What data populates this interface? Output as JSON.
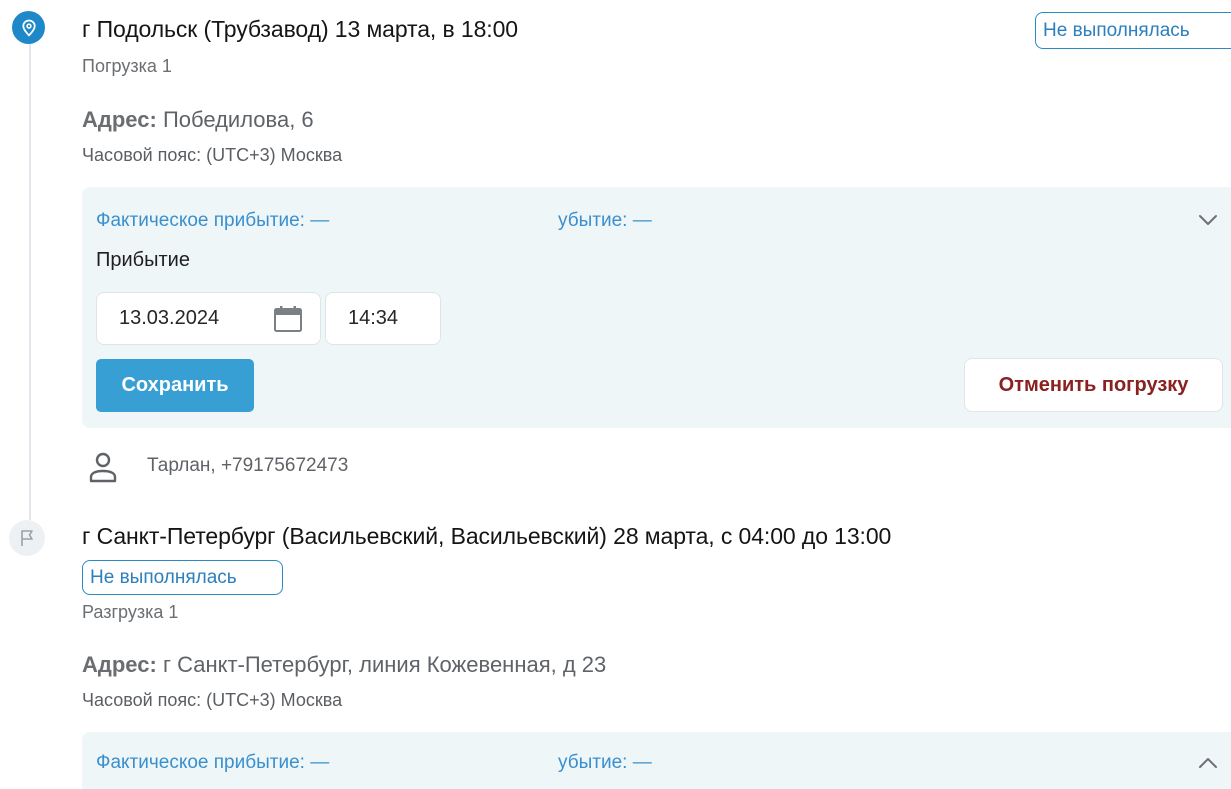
{
  "stops": [
    {
      "title": "г Подольск (Трубзавод) 13 марта, в 18:00",
      "status": "Не выполнялась",
      "type": "Погрузка 1",
      "address_label": "Адрес:",
      "address": "Победилова, 6",
      "timezone": "Часовой пояс: (UTC+3) Москва",
      "actual_arrival": "Фактическое прибытие: —",
      "actual_departure": "убытие: —",
      "form": {
        "arrival_label": "Прибытие",
        "date_value": "13.03.2024",
        "time_value": "14:34",
        "save_label": "Сохранить",
        "cancel_label": "Отменить погрузку"
      },
      "driver": "Тарлан, +79175672473"
    },
    {
      "title": "г Санкт-Петербург (Васильевский, Васильевский) 28 марта, с 04:00 до 13:00",
      "status": "Не выполнялась",
      "type": "Разгрузка 1",
      "address_label": "Адрес:",
      "address": "г Санкт-Петербург, линия Кожевенная, д 23",
      "timezone": "Часовой пояс: (UTC+3) Москва",
      "actual_arrival": "Фактическое прибытие: —",
      "actual_departure": "убытие: —"
    }
  ],
  "icons": {
    "pin": "map-pin-icon",
    "flag": "flag-icon",
    "calendar": "calendar-icon",
    "user": "user-icon",
    "chevron_down": "chevron-down-icon",
    "chevron_up": "chevron-up-icon"
  },
  "colors": {
    "accent": "#1e88c9",
    "panel_bg": "#eef6f8",
    "cancel_text": "#8b2020"
  }
}
